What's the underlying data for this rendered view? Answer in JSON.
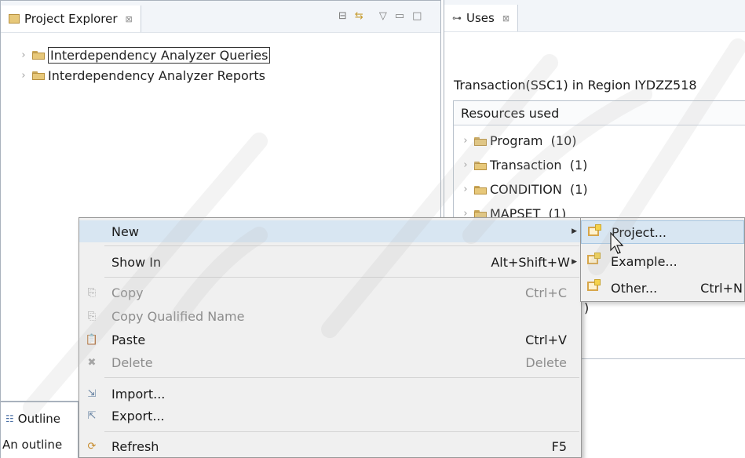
{
  "project_explorer": {
    "tab_label": "Project Explorer",
    "tab_close": "⊠",
    "items": [
      {
        "label": "Interdependency Analyzer Queries"
      },
      {
        "label": "Interdependency Analyzer Reports"
      }
    ]
  },
  "outline": {
    "tab_label": "Outline",
    "message": "An outline"
  },
  "uses_view": {
    "tab_label": "Uses",
    "tab_close": "⊠",
    "subtitle": "Transaction(SSC1) in Region IYDZZ518",
    "column_header": "Resources used",
    "items": [
      {
        "label": "Program  (10)"
      },
      {
        "label": "Transaction  (1)"
      },
      {
        "label": "CONDITION  (1)"
      },
      {
        "label": "MAPSET  (1)"
      }
    ],
    "stray_char": ")"
  },
  "context_menu": {
    "new": {
      "label": "New"
    },
    "show_in": {
      "label": "Show In",
      "shortcut": "Alt+Shift+W"
    },
    "copy": {
      "label": "Copy",
      "shortcut": "Ctrl+C"
    },
    "copy_qualified": {
      "label": "Copy Qualified Name"
    },
    "paste": {
      "label": "Paste",
      "shortcut": "Ctrl+V"
    },
    "delete": {
      "label": "Delete",
      "shortcut": "Delete"
    },
    "import": {
      "label": "Import..."
    },
    "export": {
      "label": "Export..."
    },
    "refresh": {
      "label": "Refresh",
      "shortcut": "F5"
    }
  },
  "submenu": {
    "project": {
      "label": "Project..."
    },
    "example": {
      "label": "Example..."
    },
    "other": {
      "label": "Other...",
      "shortcut": "Ctrl+N"
    }
  },
  "colors": {
    "accent_highlight": "#d8e6f2",
    "menu_bg": "#f0f0f0",
    "folder": "#e7c87a"
  }
}
